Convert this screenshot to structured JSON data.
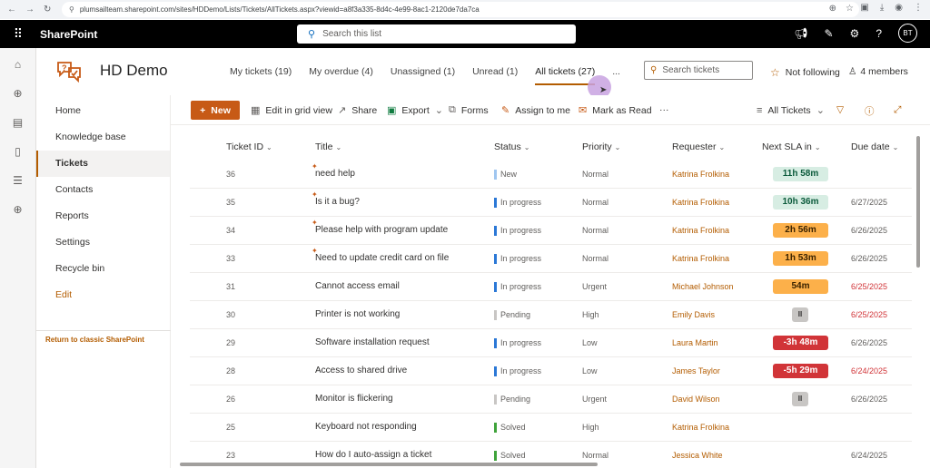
{
  "browser": {
    "url": "plumsailteam.sharepoint.com/sites/HDDemo/Lists/Tickets/AllTickets.aspx?viewid=a8f3a335-8d4c-4e99-8ac1-2120de7da7ca"
  },
  "suitebar": {
    "brand": "SharePoint",
    "search_placeholder": "Search this list",
    "avatar": "BT"
  },
  "site": {
    "title": "HD Demo",
    "tabs": [
      {
        "label": "My tickets (19)"
      },
      {
        "label": "My overdue (4)"
      },
      {
        "label": "Unassigned (1)"
      },
      {
        "label": "Unread (1)"
      },
      {
        "label": "All tickets (27)"
      },
      {
        "label": "..."
      }
    ],
    "search_placeholder": "Search tickets",
    "follow_label": "Not following",
    "members_label": "4 members"
  },
  "nav": {
    "items": [
      {
        "label": "Home"
      },
      {
        "label": "Knowledge base"
      },
      {
        "label": "Tickets"
      },
      {
        "label": "Contacts"
      },
      {
        "label": "Reports"
      },
      {
        "label": "Settings"
      },
      {
        "label": "Recycle bin"
      },
      {
        "label": "Edit"
      }
    ],
    "classic_link": "Return to classic SharePoint"
  },
  "commands": {
    "new": "New",
    "edit_grid": "Edit in grid view",
    "share": "Share",
    "export": "Export",
    "forms": "Forms",
    "assign": "Assign to me",
    "mark_read": "Mark as Read",
    "more": "···",
    "view": "All Tickets"
  },
  "columns": {
    "id": "Ticket ID",
    "title": "Title",
    "status": "Status",
    "priority": "Priority",
    "requester": "Requester",
    "sla": "Next SLA in",
    "due": "Due date"
  },
  "rows": [
    {
      "id": "36",
      "title": "need help",
      "status": "New",
      "priority": "Normal",
      "requester": "Katrina Frolkina",
      "sla": "11h 58m",
      "due": ""
    },
    {
      "id": "35",
      "title": "Is it a bug?",
      "status": "In progress",
      "priority": "Normal",
      "requester": "Katrina Frolkina",
      "sla": "10h 36m",
      "due": "6/27/2025"
    },
    {
      "id": "34",
      "title": "Please help with program update",
      "status": "In progress",
      "priority": "Normal",
      "requester": "Katrina Frolkina",
      "sla": "2h 56m",
      "due": "6/26/2025"
    },
    {
      "id": "33",
      "title": "Need to update credit card on file",
      "status": "In progress",
      "priority": "Normal",
      "requester": "Katrina Frolkina",
      "sla": "1h 53m",
      "due": "6/26/2025"
    },
    {
      "id": "31",
      "title": "Cannot access email",
      "status": "In progress",
      "priority": "Urgent",
      "requester": "Michael Johnson",
      "sla": "54m",
      "due": "6/25/2025"
    },
    {
      "id": "30",
      "title": "Printer is not working",
      "status": "Pending",
      "priority": "High",
      "requester": "Emily Davis",
      "sla": "II",
      "due": "6/25/2025"
    },
    {
      "id": "29",
      "title": "Software installation request",
      "status": "In progress",
      "priority": "Low",
      "requester": "Laura Martin",
      "sla": "-3h 48m",
      "due": "6/26/2025"
    },
    {
      "id": "28",
      "title": "Access to shared drive",
      "status": "In progress",
      "priority": "Low",
      "requester": "James Taylor",
      "sla": "-5h 29m",
      "due": "6/24/2025"
    },
    {
      "id": "26",
      "title": "Monitor is flickering",
      "status": "Pending",
      "priority": "Urgent",
      "requester": "David Wilson",
      "sla": "II",
      "due": "6/26/2025"
    },
    {
      "id": "25",
      "title": "Keyboard not responding",
      "status": "Solved",
      "priority": "High",
      "requester": "Katrina Frolkina",
      "sla": "",
      "due": ""
    },
    {
      "id": "23",
      "title": "How do I auto-assign a ticket",
      "status": "Solved",
      "priority": "Normal",
      "requester": "Jessica White",
      "sla": "",
      "due": "6/24/2025"
    }
  ],
  "colors": {
    "accent": "#c75a16",
    "new": "#9fc6f0",
    "in_progress": "#2b78d6",
    "pending": "#c8c6c4",
    "solved": "#3fa33b",
    "overdue": "#d13438"
  }
}
